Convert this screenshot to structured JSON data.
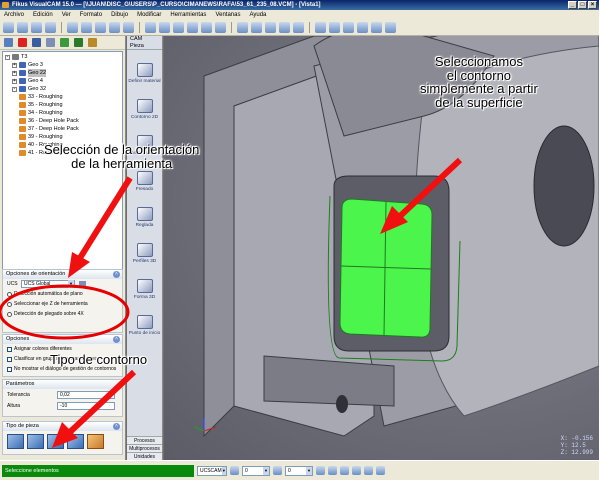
{
  "window": {
    "title": "Fikus VisualCAM 15.0 — [\\\\JUAN\\DISC_G\\USERS\\P_CURSO\\CIMANEWS\\RAFA\\53_61_235_08.VCM] - [Vista1]",
    "controls": [
      "_",
      "□",
      "×"
    ]
  },
  "menu": {
    "items": [
      "Archivo",
      "Edición",
      "Ver",
      "Formato",
      "Dibujo",
      "Modificar",
      "Herramientas",
      "Ventanas",
      "Ayuda"
    ]
  },
  "tree": {
    "items": [
      {
        "label": "T3",
        "indent": 0,
        "expand": "-",
        "icon": "folder-icon",
        "color": "#7a7a7a"
      },
      {
        "label": "Geo 3",
        "indent": 1,
        "expand": "+",
        "icon": "geometry-icon",
        "color": "#3f66b3"
      },
      {
        "label": "Geo 22",
        "indent": 1,
        "expand": "+",
        "icon": "geometry-icon",
        "color": "#3f66b3",
        "selected": true
      },
      {
        "label": "Geo 4",
        "indent": 1,
        "expand": "+",
        "icon": "geometry-icon",
        "color": "#3f66b3"
      },
      {
        "label": "Geo 32",
        "indent": 1,
        "expand": "-",
        "icon": "geometry-icon",
        "color": "#3f66b3"
      },
      {
        "label": "33 - Roughing",
        "indent": 2,
        "icon": "operation-icon",
        "color": "#e08a2a"
      },
      {
        "label": "35 - Roughing",
        "indent": 2,
        "icon": "operation-icon",
        "color": "#e08a2a"
      },
      {
        "label": "34 - Roughing",
        "indent": 2,
        "icon": "operation-icon",
        "color": "#e08a2a"
      },
      {
        "label": "36 - Deep Hole Pack",
        "indent": 2,
        "icon": "operation-icon",
        "color": "#e08a2a"
      },
      {
        "label": "37 - Deep Hole Pack",
        "indent": 2,
        "icon": "operation-icon",
        "color": "#e08a2a"
      },
      {
        "label": "39 - Roughing",
        "indent": 2,
        "icon": "operation-icon",
        "color": "#e08a2a"
      },
      {
        "label": "40 - Roughing",
        "indent": 2,
        "icon": "operation-icon",
        "color": "#e08a2a"
      },
      {
        "label": "41 - Roughing",
        "indent": 2,
        "icon": "operation-icon",
        "color": "#e08a2a"
      }
    ]
  },
  "orientation": {
    "title": "Opciones de orientación",
    "ucs_label": "UCS",
    "ucs_value": "UCS Global",
    "options": [
      {
        "label": "Detección automática de plano",
        "selected": false
      },
      {
        "label": "Seleccionar eje Z de herramienta",
        "selected": false
      },
      {
        "label": "Detección de plegado sobre 4X",
        "selected": false
      }
    ]
  },
  "options_section": {
    "title": "Opciones",
    "checks": [
      {
        "label": "Asignar colores diferentes",
        "checked": false
      },
      {
        "label": "Clasificar en grupos de capas colores",
        "checked": false
      },
      {
        "label": "No mostrar el diálogo de gestión de contornos",
        "checked": false
      }
    ]
  },
  "params": {
    "title": "Parámetros",
    "rows": [
      {
        "label": "Tolerancia",
        "value": "0,02"
      },
      {
        "label": "Altura",
        "value": "-10"
      }
    ]
  },
  "piece_type": {
    "title": "Tipo de pieza",
    "count": 5
  },
  "cam": {
    "header": "CAM",
    "subheader": "Pieza",
    "items": [
      "Definir material",
      "Contorno 2D",
      "Vaciado 2D",
      "Fresado",
      "Reglada",
      "Perfiles 3D",
      "Forma 3D",
      "Punto de inicio"
    ],
    "footer": [
      "Procesos",
      "Multiprocesos",
      "Unidades"
    ]
  },
  "viewport": {
    "coords": [
      "X: -0.156",
      "Y: 12.5",
      "Z: 12.999"
    ]
  },
  "annotations": {
    "surface": [
      "Seleccionamos",
      "el contorno",
      "simplemente a partir",
      "de la superficie"
    ],
    "orientation": [
      "Selección de la orientación",
      "de la herramienta"
    ],
    "contour": "Tipo de contorno"
  },
  "status": {
    "message": "Seleccione elementos",
    "ucs_combo": "UCSCAM",
    "layer_combo": "0",
    "num_combo": "0"
  },
  "colors": {
    "surface_highlight": "#4cf54c",
    "arrow_red": "#f01010",
    "ellipse_red": "#e60000",
    "status_green": "#0a8a0a"
  }
}
